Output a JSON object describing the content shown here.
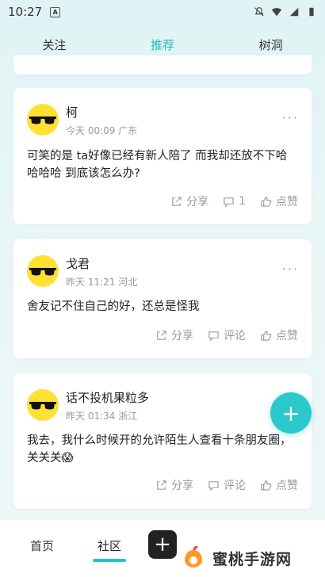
{
  "status": {
    "time": "10:27",
    "app_icon_letter": "A"
  },
  "tabs": [
    {
      "label": "关注",
      "active": false
    },
    {
      "label": "推荐",
      "active": true
    },
    {
      "label": "树洞",
      "active": false
    }
  ],
  "posts": [
    {
      "name": "柯",
      "meta": "今天 00:09 广东",
      "text": "可笑的是 ta好像已经有新人陪了 而我却还放不下哈哈哈哈 到底该怎么办?",
      "share": "分享",
      "comment": "1",
      "like": "点赞"
    },
    {
      "name": "戈君",
      "meta": "昨天 11:21 河北",
      "text": "舍友记不住自己的好，还总是怪我",
      "share": "分享",
      "comment": "评论",
      "like": "点赞"
    },
    {
      "name": "话不投机果粒多",
      "meta": "昨天 01:34 浙江",
      "text": "我去，我什么时候开的允许陌生人查看十条朋友圈，关关关😱",
      "share": "分享",
      "comment": "评论",
      "like": "点赞"
    }
  ],
  "bottom_nav": {
    "home": "首页",
    "community": "社区"
  },
  "watermark": {
    "text": "蜜桃手游网"
  },
  "colors": {
    "accent": "#25c3c9",
    "avatar_bg": "#ffe033"
  }
}
